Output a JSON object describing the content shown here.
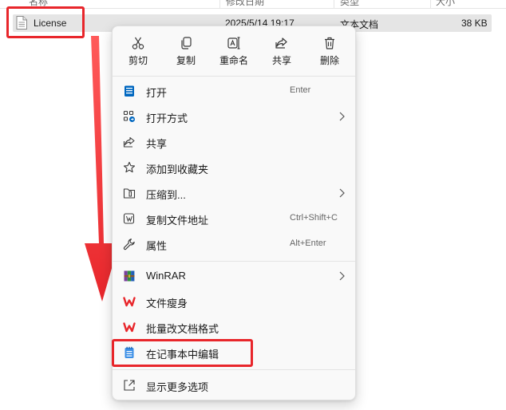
{
  "columns": {
    "name": "名称",
    "date": "修改日期",
    "type": "类型",
    "size": "大小"
  },
  "file": {
    "name": "License",
    "date": "2025/5/14 19:17",
    "type": "文本文档",
    "size": "38 KB"
  },
  "quick_actions": [
    {
      "label": "剪切",
      "icon": "scissors-icon"
    },
    {
      "label": "复制",
      "icon": "copy-icon"
    },
    {
      "label": "重命名",
      "icon": "rename-icon"
    },
    {
      "label": "共享",
      "icon": "share-icon"
    },
    {
      "label": "删除",
      "icon": "trash-icon"
    }
  ],
  "menu_items": [
    {
      "label": "打开",
      "shortcut": "Enter",
      "icon": "notepad-icon"
    },
    {
      "label": "打开方式",
      "icon": "open-with-icon"
    },
    {
      "label": "共享",
      "icon": "share-icon"
    },
    {
      "label": "添加到收藏夹",
      "icon": "star-icon"
    },
    {
      "label": "压缩到...",
      "icon": "zip-folder-icon"
    },
    {
      "label": "复制文件地址",
      "shortcut": "Ctrl+Shift+C",
      "icon": "copy-path-icon"
    },
    {
      "label": "属性",
      "shortcut": "Alt+Enter",
      "icon": "wrench-icon"
    },
    {
      "label": "WinRAR",
      "icon": "winrar-icon"
    },
    {
      "label": "文件瘦身",
      "icon": "wps-icon"
    },
    {
      "label": "批量改文档格式",
      "icon": "wps-icon"
    },
    {
      "label": "在记事本中编辑",
      "icon": "notepad-icon"
    },
    {
      "label": "显示更多选项",
      "icon": "more-options-icon"
    }
  ],
  "colors": {
    "highlight": "#e8262b",
    "accent": "#0067c0",
    "wps": "#e8262b"
  }
}
